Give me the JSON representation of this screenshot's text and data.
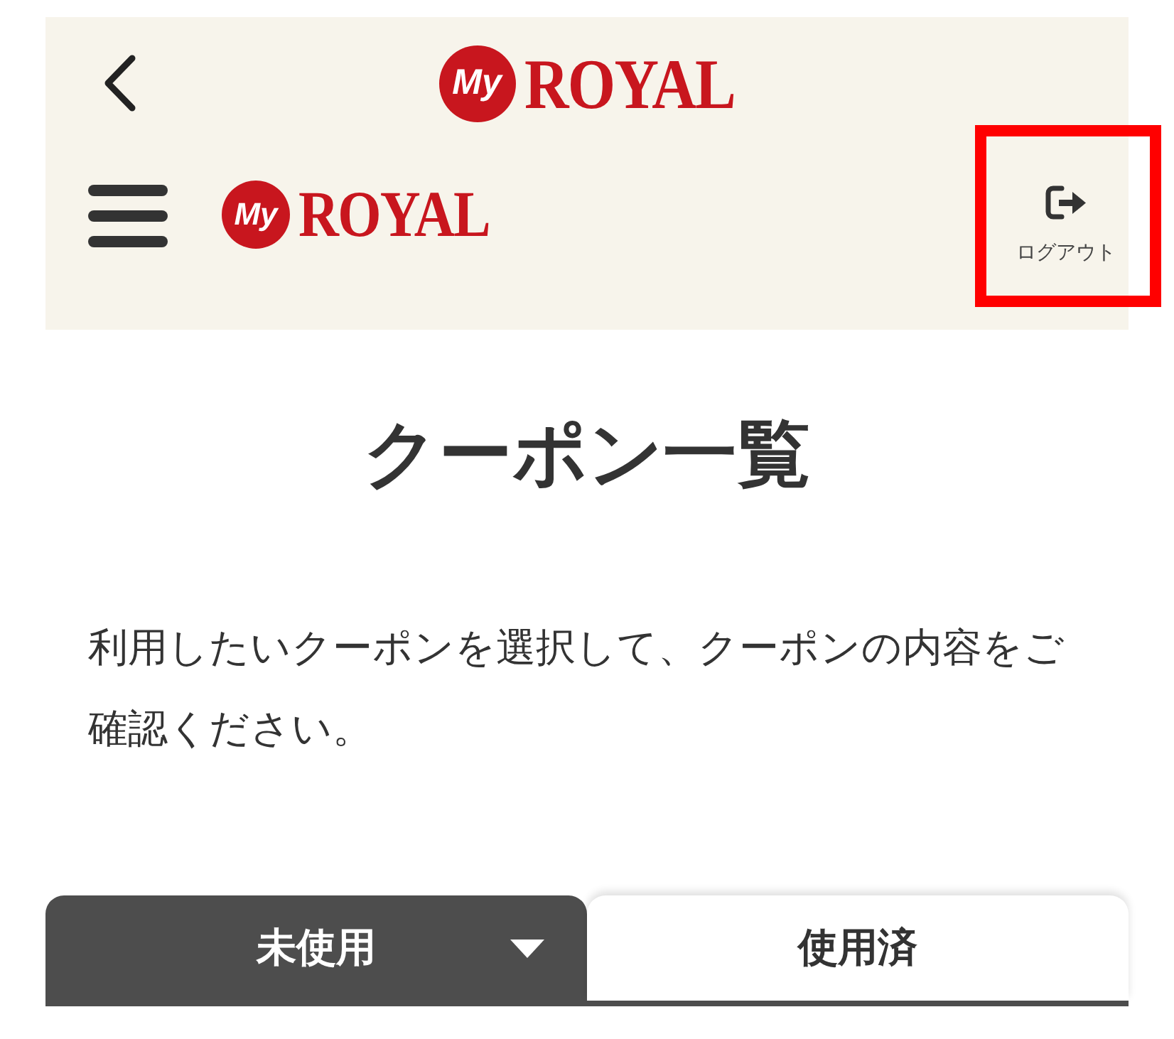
{
  "header": {
    "top_logo": {
      "badge": "My",
      "wordmark": "ROYAL"
    },
    "nav_logo": {
      "badge": "My",
      "wordmark": "ROYAL"
    },
    "logout": {
      "label": "ログアウト",
      "highlighted": true
    }
  },
  "page_title": "クーポン一覧",
  "description": "利用したいクーポンを選択して、クーポンの内容をご確認ください。",
  "tabs": [
    {
      "label": "未使用",
      "selected": true
    },
    {
      "label": "使用済",
      "selected": false
    }
  ]
}
